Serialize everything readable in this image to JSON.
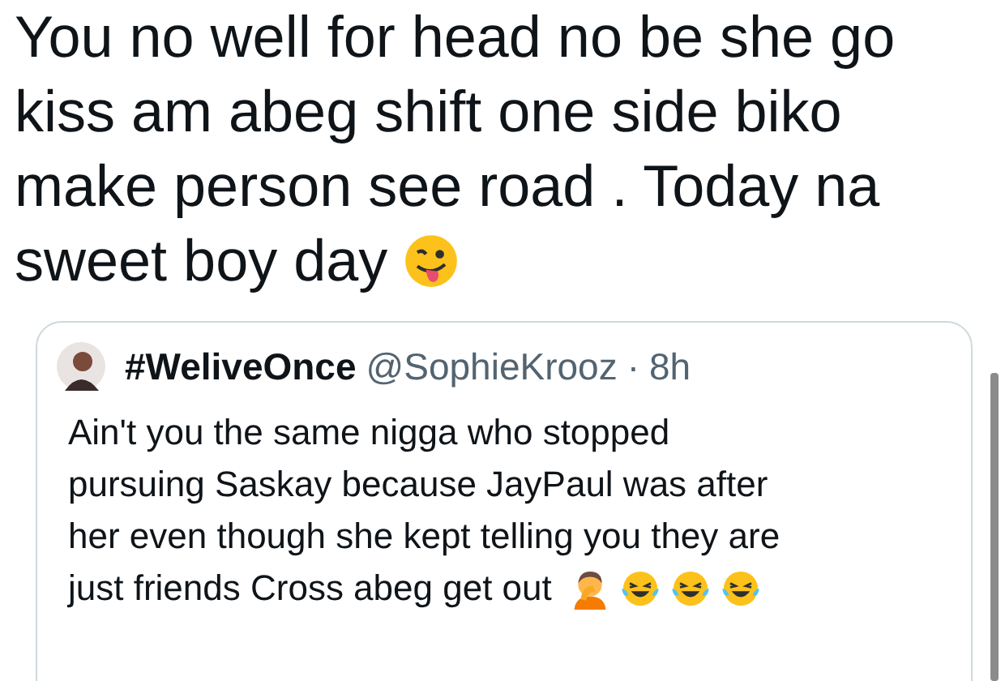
{
  "tweet": {
    "lines": [
      "You no well for head no be she go",
      "kiss am abeg shift one side biko",
      "make person see road . Today na",
      "sweet boy day"
    ]
  },
  "quoted_tweet": {
    "display_name": "#WeliveOnce",
    "handle": "@SophieKrooz",
    "separator": "·",
    "time": "8h",
    "lines": [
      "Ain't you the same nigga who stopped",
      "pursuing Saskay because JayPaul was after",
      "her even though she kept telling you they are",
      "just friends Cross abeg get out"
    ]
  }
}
